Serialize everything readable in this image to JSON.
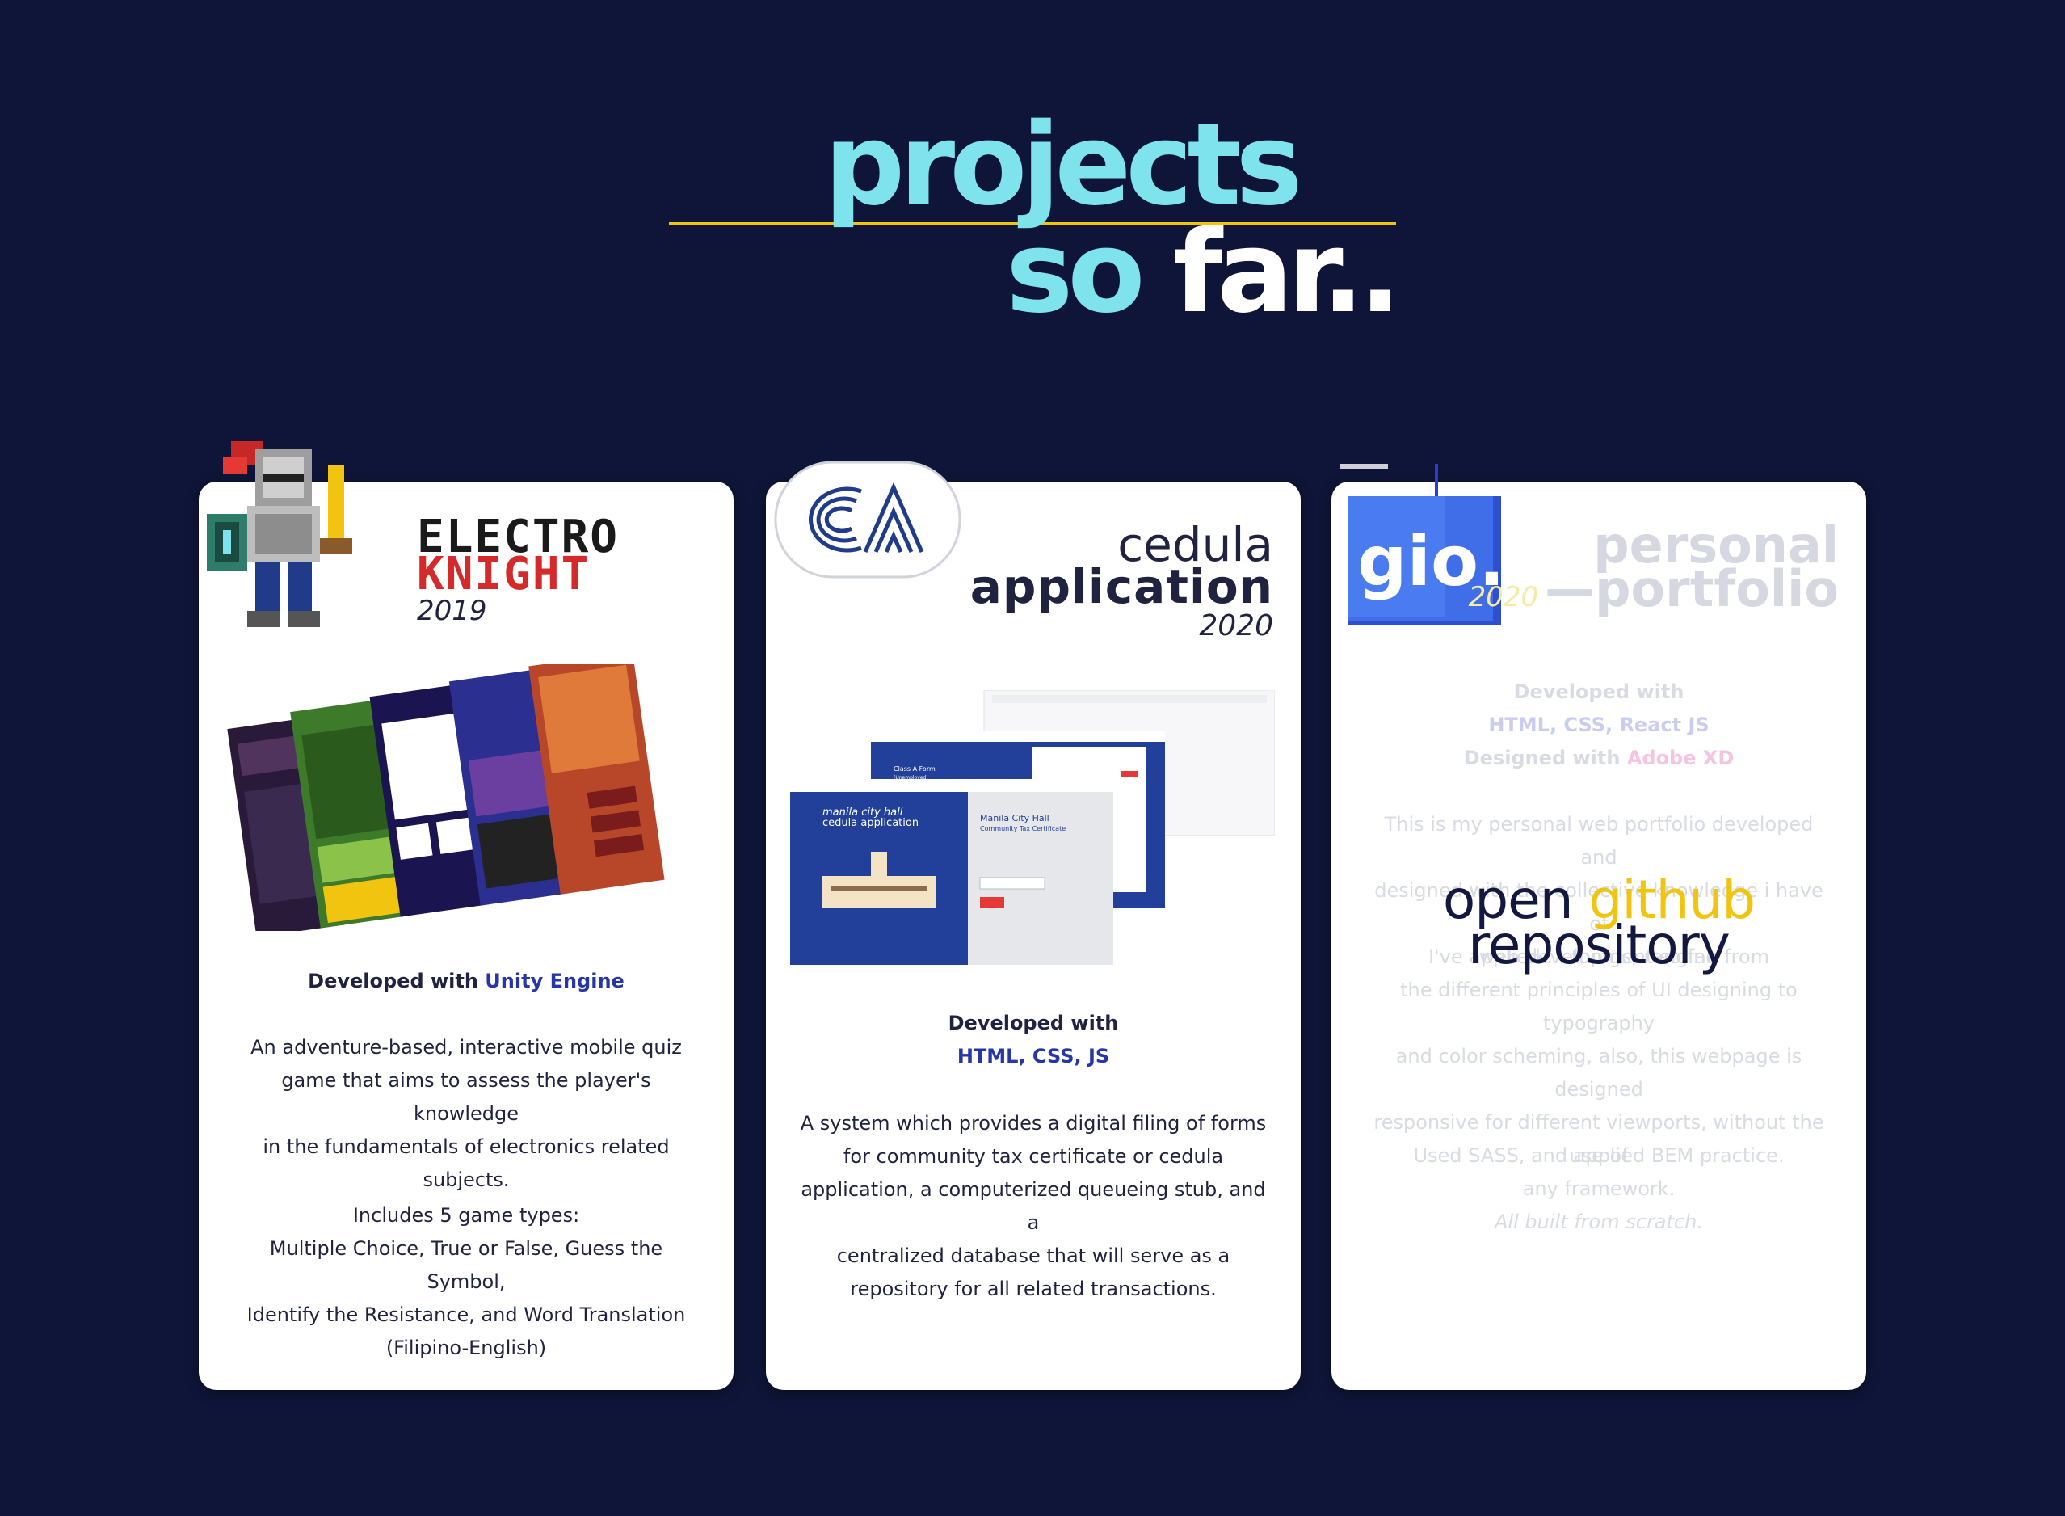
{
  "heading": {
    "line1": "projects",
    "line2_part1": "so ",
    "line2_part2": "far.."
  },
  "colors": {
    "background": "#0f1538",
    "accent_cyan": "#7fe3ee",
    "accent_yellow": "#f1c40f",
    "tech_blue": "#2636a8"
  },
  "projects": [
    {
      "logo_icon": "pixel-knight-icon",
      "title_line1": "ELECTRO",
      "title_line2": "KNIGHT",
      "year": "2019",
      "screens_image": "game-screens-collage",
      "dev_label": "Developed with ",
      "dev_tech": "Unity Engine",
      "desc_lines": [
        "An adventure-based, interactive mobile quiz",
        "game that aims to assess the player's knowledge",
        "in the fundamentals of electronics related",
        "subjects."
      ],
      "types_heading": "Includes 5 game types:",
      "types_lines": [
        "Multiple Choice, True or False, Guess the Symbol,",
        "Identify the Resistance, and Word Translation",
        "(Filipino-English)"
      ]
    },
    {
      "logo_icon": "ca-logo-icon",
      "title_line1": "cedula",
      "title_line2": "application",
      "year": "2020",
      "screens_image": "web-app-screens",
      "mock": {
        "brand": "manila city hall",
        "app": "cedula application",
        "panel_title": "Manila City Hall",
        "panel_sub": "Community Tax Certificate",
        "form_title": "Class A Form",
        "form_sub": "(Unemployed)"
      },
      "dev_label": "Developed with",
      "dev_tech": "HTML, CSS, JS",
      "desc_lines": [
        "A system which provides a digital filing of forms",
        "for community tax certificate or cedula",
        "application, a computerized queueing stub, and a",
        "centralized database that will serve as a",
        "repository for all related transactions."
      ]
    },
    {
      "logo_icon": "gio-logo-icon",
      "logo_text": "gio.",
      "title_line1": "personal",
      "title_line2": "—portfolio",
      "year": "2020",
      "dev_label": "Developed with",
      "dev_tech": "HTML, CSS, React JS",
      "design_label": "Designed with ",
      "design_tech": "Adobe XD",
      "desc_lines": [
        "This is my personal web portfolio developed and",
        "designed with the collective knowledge i have of",
        "web development so far."
      ],
      "desc2_lines": [
        "I've applied ... things, ranging from",
        "the different principles of UI designing to typography",
        "and color scheming, also, this webpage is designed",
        "responsive for different viewports, without the use of",
        "any framework."
      ],
      "practice": "Used SASS, and applied BEM practice.",
      "scratch": "All built from scratch.",
      "overlay_part1": "open ",
      "overlay_part2": "github",
      "overlay_line2": "repository"
    }
  ]
}
